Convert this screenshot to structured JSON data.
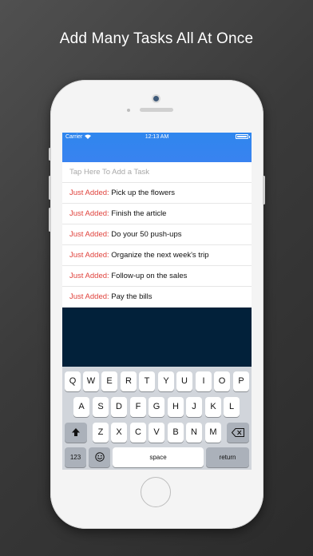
{
  "promo": {
    "title": "Add Many Tasks All At Once"
  },
  "status_bar": {
    "carrier": "Carrier",
    "time": "12:13 AM"
  },
  "task_input": {
    "placeholder": "Tap Here To Add a Task"
  },
  "tasks": [
    {
      "prefix": "Just Added:",
      "text": "Pick up the flowers"
    },
    {
      "prefix": "Just Added:",
      "text": "Finish the article"
    },
    {
      "prefix": "Just Added:",
      "text": "Do your 50 push-ups"
    },
    {
      "prefix": "Just Added:",
      "text": "Organize the next week's trip"
    },
    {
      "prefix": "Just Added:",
      "text": "Follow-up on the sales"
    },
    {
      "prefix": "Just Added:",
      "text": "Pay the bills"
    }
  ],
  "keyboard": {
    "row1": [
      "Q",
      "W",
      "E",
      "R",
      "T",
      "Y",
      "U",
      "I",
      "O",
      "P"
    ],
    "row2": [
      "A",
      "S",
      "D",
      "F",
      "G",
      "H",
      "J",
      "K",
      "L"
    ],
    "row3": [
      "Z",
      "X",
      "C",
      "V",
      "B",
      "N",
      "M"
    ],
    "numbers_label": "123",
    "space_label": "space",
    "return_label": "return"
  },
  "colors": {
    "header_blue": "#3b82f0",
    "prefix_red": "#e0423c",
    "dark_panel": "#02213a"
  }
}
